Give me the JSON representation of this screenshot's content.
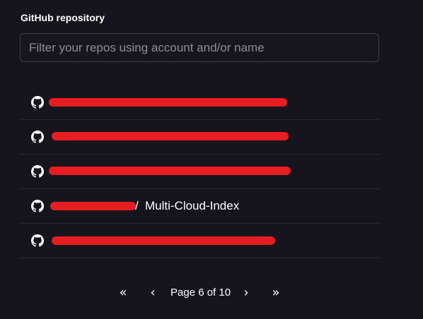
{
  "section": {
    "title": "GitHub repository"
  },
  "search": {
    "placeholder": "Filter your repos using account and/or name",
    "value": ""
  },
  "repos": [
    {
      "icon": "github-icon",
      "name": "",
      "redacted": true
    },
    {
      "icon": "github-icon",
      "name": "",
      "redacted": true
    },
    {
      "icon": "github-icon",
      "name": "",
      "redacted": true
    },
    {
      "icon": "github-icon",
      "separator": "/",
      "name": "Multi-Cloud-Index",
      "redacted_owner": true
    },
    {
      "icon": "github-icon",
      "name": "",
      "redacted": true
    }
  ],
  "pagination": {
    "first_icon": "first-page-icon",
    "prev_icon": "prev-page-icon",
    "label": "Page 6 of 10",
    "current_page": 6,
    "total_pages": 10,
    "next_icon": "next-page-icon",
    "last_icon": "last-page-icon",
    "first_glyph": "«",
    "prev_glyph": "‹",
    "next_glyph": "›",
    "last_glyph": "»"
  },
  "colors": {
    "background": "#16141d",
    "border": "#3f3c4a",
    "divider": "#2c2936",
    "redaction": "#e81d22",
    "text": "#ffffff",
    "placeholder": "#8f8c99"
  }
}
